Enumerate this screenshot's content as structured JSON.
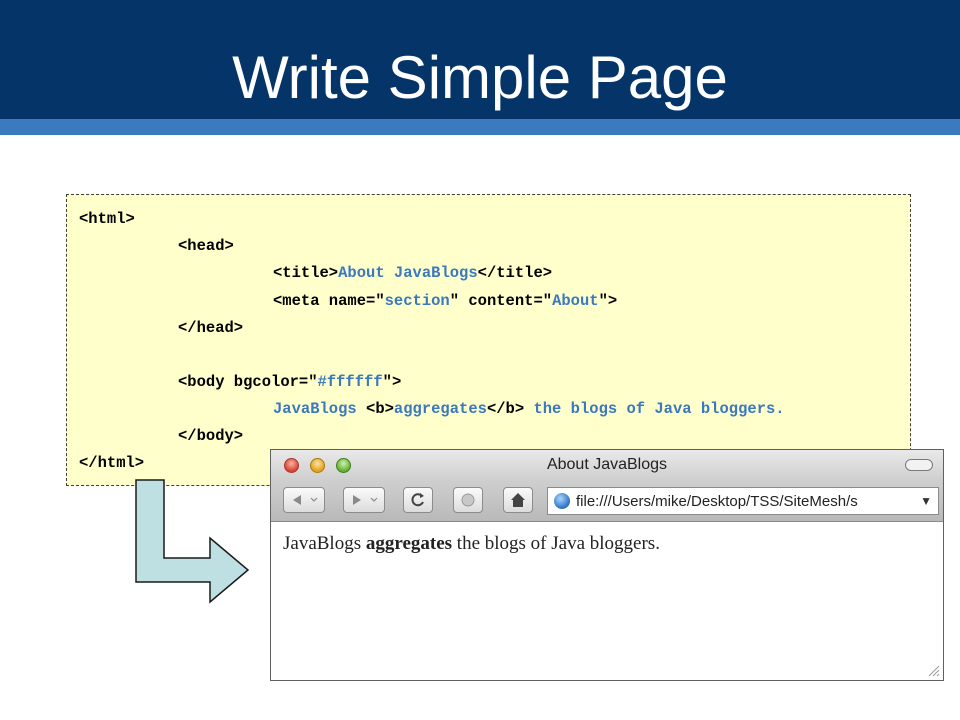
{
  "slide": {
    "title": "Write Simple Page"
  },
  "code": {
    "l1": "<html>",
    "l2": "<head>",
    "l3_open": "<title>",
    "l3_text": "About JavaBlogs",
    "l3_close": "</title>",
    "l4_pre": "<meta name=\"",
    "l4_name": "section",
    "l4_mid": "\" content=\"",
    "l4_content": "About",
    "l4_post": "\">",
    "l5": "</head>",
    "l6_pre": "<body bgcolor=\"",
    "l6_color": "#ffffff",
    "l6_post": "\">",
    "l7_a": "JavaBlogs ",
    "l7_b_open": "<b>",
    "l7_b_text": "aggregates",
    "l7_b_close": "</b>",
    "l7_c": " the blogs of Java bloggers.",
    "l8": "</body>",
    "l9": "</html>"
  },
  "browser": {
    "window_title": "About JavaBlogs",
    "address": "file:///Users/mike/Desktop/TSS/SiteMesh/s",
    "back_icon": "back-arrow-icon",
    "forward_icon": "forward-arrow-icon",
    "reload_icon": "reload-icon",
    "stop_icon": "stop-icon",
    "home_icon": "home-icon",
    "page": {
      "text_before": "JavaBlogs ",
      "text_bold": "aggregates",
      "text_after": " the blogs of Java bloggers."
    }
  },
  "colors": {
    "title_bar": "#053468",
    "title_stripe": "#3c7ac0",
    "code_bg": "#ffffcc",
    "code_string": "#3a78c0",
    "arrow_fill": "#bfe0e2"
  }
}
